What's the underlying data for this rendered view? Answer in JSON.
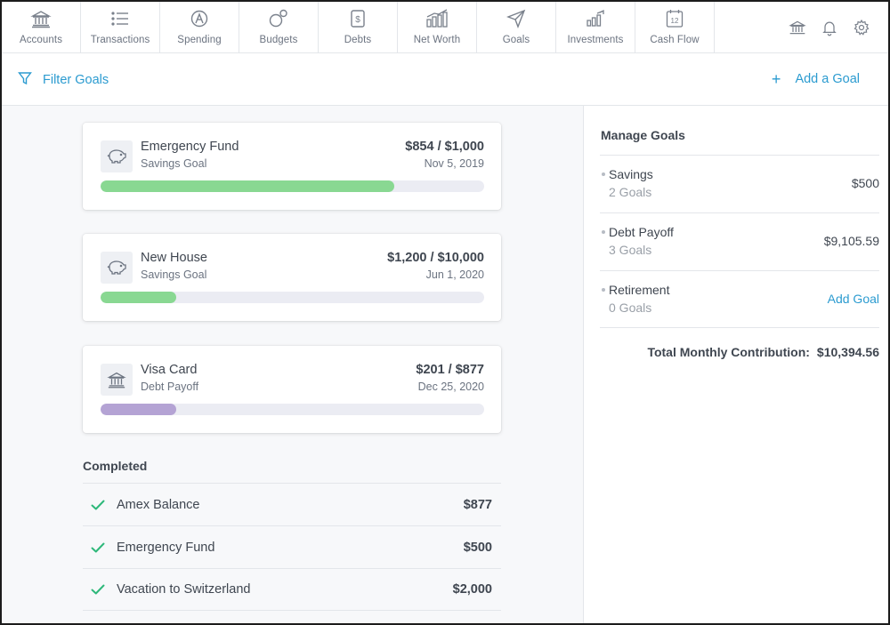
{
  "nav": {
    "items": [
      {
        "label": "Accounts",
        "icon": "bank-icon"
      },
      {
        "label": "Transactions",
        "icon": "list-icon"
      },
      {
        "label": "Spending",
        "icon": "spending-icon"
      },
      {
        "label": "Budgets",
        "icon": "budgets-icon"
      },
      {
        "label": "Debts",
        "icon": "dollar-doc-icon"
      },
      {
        "label": "Net Worth",
        "icon": "bar-chart-icon"
      },
      {
        "label": "Goals",
        "icon": "paper-plane-icon"
      },
      {
        "label": "Investments",
        "icon": "growth-icon"
      },
      {
        "label": "Cash Flow",
        "icon": "calendar-icon"
      }
    ],
    "calendar_day": "12",
    "right_icons": [
      "institution-icon",
      "bell-icon",
      "gear-icon"
    ]
  },
  "toolbar": {
    "filter_label": "Filter Goals",
    "add_plus": "+",
    "add_label": "Add a Goal"
  },
  "goals": [
    {
      "name": "Emergency Fund",
      "type": "Savings Goal",
      "amount": "$854 / $1,000",
      "date": "Nov 5, 2019",
      "progress": 0.765,
      "color": "#89d892",
      "icon": "piggy-bank-icon"
    },
    {
      "name": "New House",
      "type": "Savings Goal",
      "amount": "$1,200 / $10,000",
      "date": "Jun 1, 2020",
      "progress": 0.197,
      "color": "#89d892",
      "icon": "piggy-bank-icon"
    },
    {
      "name": "Visa Card",
      "type": "Debt Payoff",
      "amount": "$201 / $877",
      "date": "Dec 25, 2020",
      "progress": 0.197,
      "color": "#b4a3d4",
      "icon": "bank-icon"
    }
  ],
  "completed": {
    "title": "Completed",
    "items": [
      {
        "name": "Amex Balance",
        "amount": "$877"
      },
      {
        "name": "Emergency Fund",
        "amount": "$500"
      },
      {
        "name": "Vacation to Switzerland",
        "amount": "$2,000"
      }
    ]
  },
  "manage": {
    "title": "Manage Goals",
    "rows": [
      {
        "name": "Savings",
        "count": "2 Goals",
        "value": "$500"
      },
      {
        "name": "Debt Payoff",
        "count": "3 Goals",
        "value": "$9,105.59"
      },
      {
        "name": "Retirement",
        "count": "0 Goals",
        "link": "Add Goal"
      }
    ],
    "total_label": "Total Monthly Contribution:",
    "total_value": "$10,394.56"
  },
  "colors": {
    "accent": "#2b9bd0",
    "check": "#2eb87a",
    "savings_bar": "#89d892",
    "debt_bar": "#b4a3d4",
    "track": "#ebecf3"
  }
}
